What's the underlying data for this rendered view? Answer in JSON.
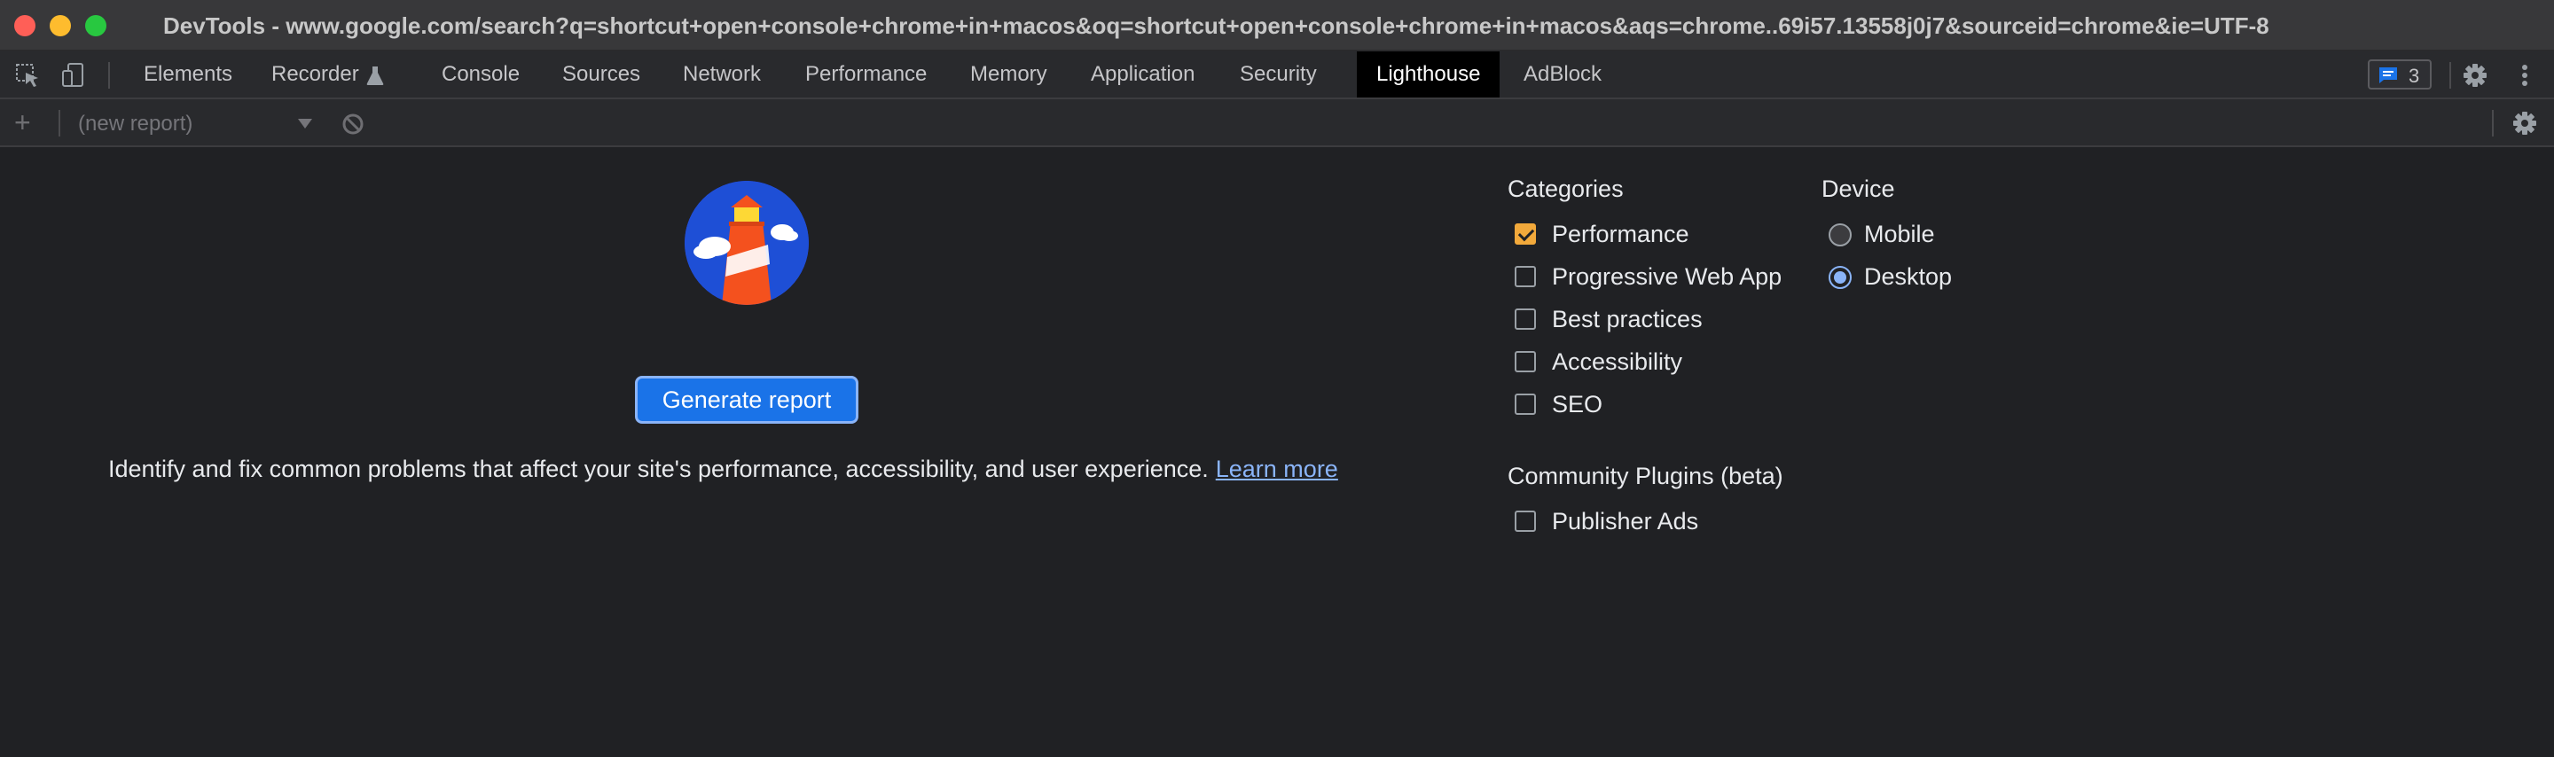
{
  "window": {
    "title": "DevTools - www.google.com/search?q=shortcut+open+console+chrome+in+macos&oq=shortcut+open+console+chrome+in+macos&aqs=chrome..69i57.13558j0j7&sourceid=chrome&ie=UTF-8"
  },
  "tabs": [
    {
      "label": "Elements"
    },
    {
      "label": "Recorder"
    },
    {
      "label": "Console"
    },
    {
      "label": "Sources"
    },
    {
      "label": "Network"
    },
    {
      "label": "Performance"
    },
    {
      "label": "Memory"
    },
    {
      "label": "Application"
    },
    {
      "label": "Security"
    },
    {
      "label": "Lighthouse",
      "active": true
    },
    {
      "label": "AdBlock"
    }
  ],
  "issues_badge": {
    "count": "3"
  },
  "subbar": {
    "add_label": "+",
    "report_select": "(new report)"
  },
  "main": {
    "generate_button": "Generate report",
    "description": "Identify and fix common problems that affect your site's performance, accessibility, and user experience.",
    "learn_more": "Learn more"
  },
  "categories": {
    "heading": "Categories",
    "items": [
      {
        "label": "Performance",
        "checked": true
      },
      {
        "label": "Progressive Web App",
        "checked": false
      },
      {
        "label": "Best practices",
        "checked": false
      },
      {
        "label": "Accessibility",
        "checked": false
      },
      {
        "label": "SEO",
        "checked": false
      }
    ]
  },
  "device": {
    "heading": "Device",
    "items": [
      {
        "label": "Mobile",
        "selected": false
      },
      {
        "label": "Desktop",
        "selected": true
      }
    ]
  },
  "plugins": {
    "heading": "Community Plugins (beta)",
    "items": [
      {
        "label": "Publisher Ads",
        "checked": false
      }
    ]
  },
  "colors": {
    "accent": "#1a73e8",
    "checkbox_checked": "#f2a93b",
    "link": "#8ab4f8",
    "background": "#202124"
  }
}
